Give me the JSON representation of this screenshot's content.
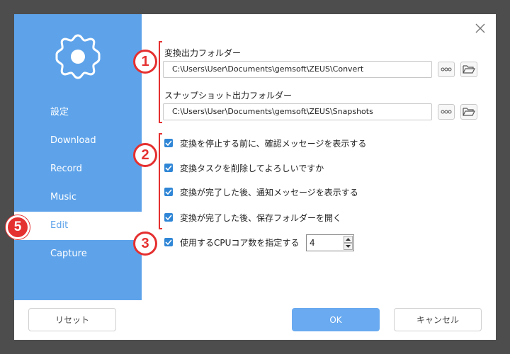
{
  "sidebar": {
    "items": [
      {
        "label": "設定"
      },
      {
        "label": "Download"
      },
      {
        "label": "Record"
      },
      {
        "label": "Music"
      },
      {
        "label": "Edit"
      },
      {
        "label": "Capture"
      }
    ]
  },
  "output_folder": {
    "label": "変換出力フォルダー",
    "path": "C:\\Users\\User\\Documents\\gemsoft\\ZEUS\\Convert"
  },
  "snapshot_folder": {
    "label": "スナップショット出力フォルダー",
    "path": "C:\\Users\\User\\Documents\\gemsoft\\ZEUS\\Snapshots"
  },
  "checkboxes": [
    {
      "label": "変換を停止する前に、確認メッセージを表示する",
      "checked": true
    },
    {
      "label": "変換タスクを削除してよろしいですか",
      "checked": true
    },
    {
      "label": "変換が完了した後、通知メッセージを表示する",
      "checked": true
    },
    {
      "label": "変換が完了した後、保存フォルダーを開く",
      "checked": true
    }
  ],
  "cpu_cores": {
    "label": "使用するCPUコア数を指定する",
    "checked": true,
    "value": "4"
  },
  "footer": {
    "reset_label": "リセット",
    "ok_label": "OK",
    "cancel_label": "キャンセル"
  },
  "annotations": [
    "1",
    "2",
    "3",
    "5"
  ],
  "colors": {
    "sidebar": "#5ea3ea",
    "accent": "#2f86d6",
    "ok": "#6aaaf0",
    "annotation": "#e53030"
  }
}
